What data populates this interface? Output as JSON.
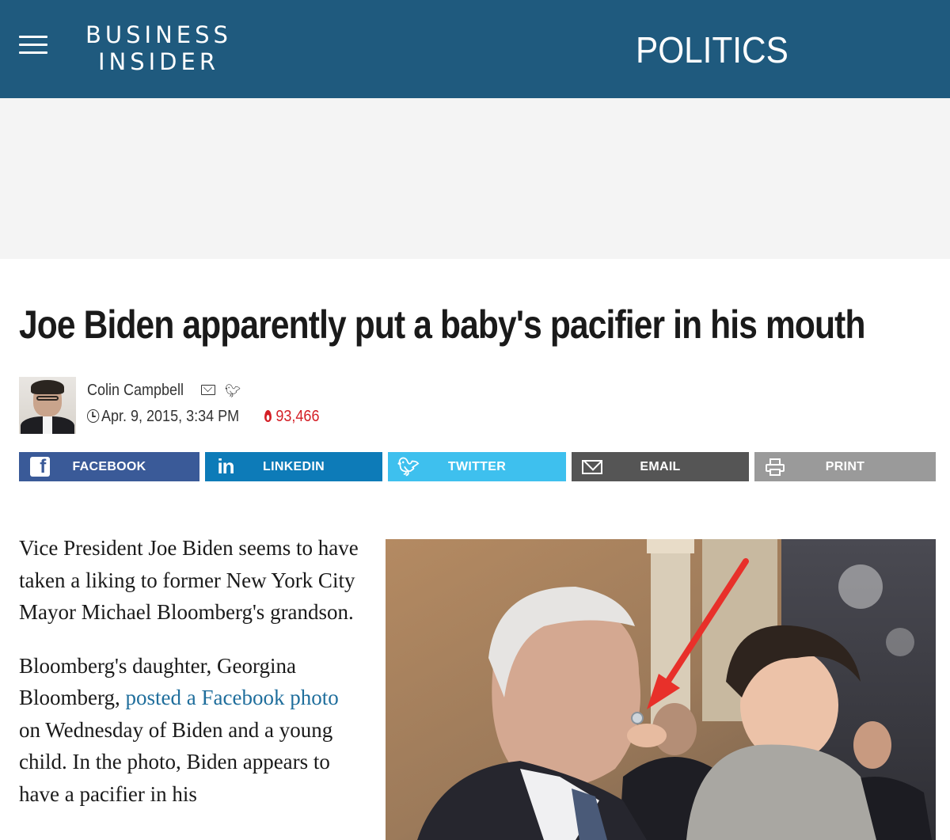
{
  "header": {
    "logo_line1": "BUSINESS",
    "logo_line2": "INSIDER",
    "section": "POLITICS",
    "background_color": "#1f5a7e"
  },
  "article": {
    "headline": "Joe Biden apparently put a baby's pacifier in his mouth",
    "author": "Colin Campbell",
    "date": "Apr. 9, 2015, 3:34 PM",
    "views": "93,466",
    "paragraphs": [
      {
        "text": "Vice President Joe Biden seems to have taken a liking to former New York City Mayor Michael Bloomberg's grandson."
      },
      {
        "before": "Bloomberg's daughter, Georgina Bloomberg, ",
        "link": "posted a Facebook photo",
        "after": " on Wednesday of Biden and a young child. In the photo, Biden appears to have a pacifier in his"
      }
    ]
  },
  "share": {
    "facebook": "FACEBOOK",
    "linkedin": "LINKEDIN",
    "twitter": "TWITTER",
    "email": "EMAIL",
    "print": "PRINT"
  },
  "icons": {
    "menu": "hamburger-menu-icon",
    "mail": "envelope-icon",
    "twitter": "twitter-bird-icon",
    "clock": "clock-icon",
    "trending": "flame-icon",
    "print": "printer-icon"
  },
  "colors": {
    "link": "#1f6e9c",
    "views": "#d41f26",
    "facebook": "#3a5a98",
    "linkedin": "#0d7bb8",
    "twitter": "#3ec0ee",
    "email": "#555555",
    "print": "#9a9a9a"
  }
}
